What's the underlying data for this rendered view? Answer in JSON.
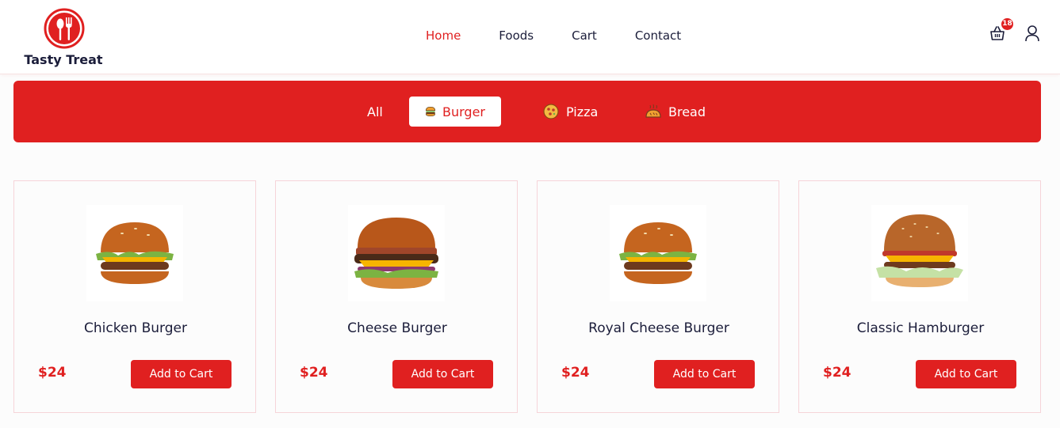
{
  "brand": {
    "name": "Tasty Treat"
  },
  "colors": {
    "accent": "#e02020",
    "text": "#1b1d3a",
    "card_border": "#f6d4d9"
  },
  "nav": {
    "items": [
      {
        "label": "Home",
        "active": true
      },
      {
        "label": "Foods"
      },
      {
        "label": "Cart"
      },
      {
        "label": "Contact"
      }
    ]
  },
  "header": {
    "cart_count": "18",
    "cart_icon": "shopping-basket-icon",
    "user_icon": "user-icon"
  },
  "categories": {
    "items": [
      {
        "label": "All"
      },
      {
        "label": "Burger",
        "icon": "burger-icon",
        "active": true
      },
      {
        "label": "Pizza",
        "icon": "pizza-icon"
      },
      {
        "label": "Bread",
        "icon": "bread-icon"
      }
    ]
  },
  "products": [
    {
      "name": "Chicken Burger",
      "price": "$24",
      "button": "Add to Cart"
    },
    {
      "name": "Cheese Burger",
      "price": "$24",
      "button": "Add to Cart"
    },
    {
      "name": "Royal Cheese Burger",
      "price": "$24",
      "button": "Add to Cart"
    },
    {
      "name": "Classic Hamburger",
      "price": "$24",
      "button": "Add to Cart"
    }
  ]
}
